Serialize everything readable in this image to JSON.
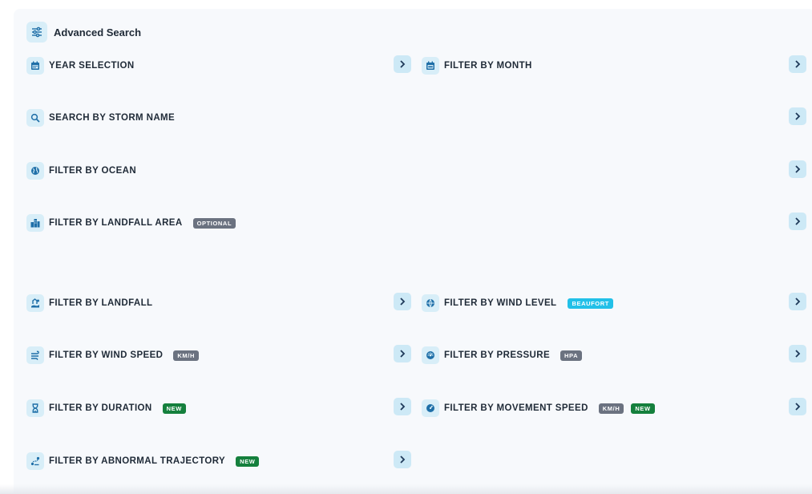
{
  "header": {
    "title": "Advanced Search",
    "icon": "sliders-icon"
  },
  "filters": [
    {
      "label": "YEAR SELECTION",
      "icon": "calendar-icon",
      "badges": []
    },
    {
      "label": "FILTER BY MONTH",
      "icon": "calendar-day-icon",
      "badges": []
    },
    {
      "label": "SEARCH BY STORM NAME",
      "icon": "search-icon",
      "badges": []
    },
    {
      "label": "FILTER BY OCEAN",
      "icon": "globe-icon",
      "badges": []
    },
    {
      "label": "FILTER BY LANDFALL AREA",
      "icon": "city-icon",
      "badges": [
        {
          "text": "OPTIONAL",
          "color": "#6b7280"
        }
      ]
    },
    {
      "label": "FILTER BY LANDFALL",
      "icon": "landfall-icon",
      "badges": []
    },
    {
      "label": "FILTER BY WIND LEVEL",
      "icon": "wind-level-icon",
      "badges": [
        {
          "text": "BEAUFORT",
          "color": "#22c0e8"
        }
      ]
    },
    {
      "label": "FILTER BY WIND SPEED",
      "icon": "wind-icon",
      "badges": [
        {
          "text": "KM/H",
          "color": "#6b7280"
        }
      ]
    },
    {
      "label": "FILTER BY PRESSURE",
      "icon": "pressure-icon",
      "badges": [
        {
          "text": "HPA",
          "color": "#6b7280"
        }
      ]
    },
    {
      "label": "FILTER BY DURATION",
      "icon": "hourglass-icon",
      "badges": [
        {
          "text": "NEW",
          "color": "#15803d"
        }
      ]
    },
    {
      "label": "FILTER BY MOVEMENT SPEED",
      "icon": "gauge-icon",
      "badges": [
        {
          "text": "KM/H",
          "color": "#6b7280"
        },
        {
          "text": "NEW",
          "color": "#15803d"
        }
      ]
    },
    {
      "label": "FILTER BY ABNORMAL TRAJECTORY",
      "icon": "trajectory-icon",
      "badges": [
        {
          "text": "NEW",
          "color": "#15803d"
        }
      ]
    }
  ],
  "colors": {
    "accent": "#1f6fa8",
    "icon_bg": "#d8eef8",
    "panel_bg": "#f7f9fc"
  }
}
